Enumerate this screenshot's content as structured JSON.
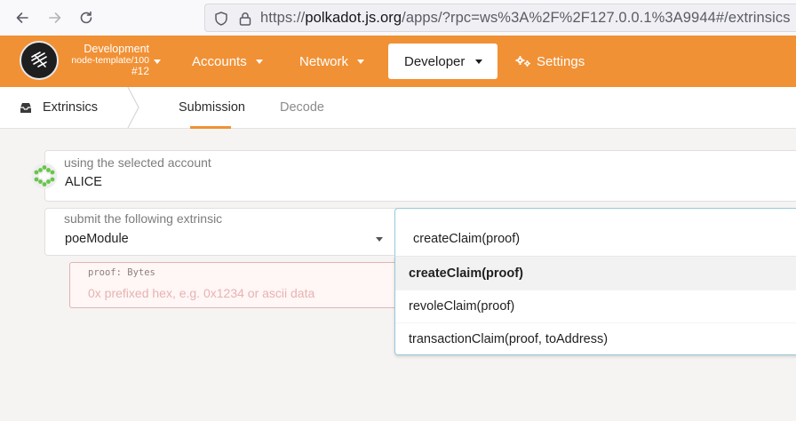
{
  "browser": {
    "url_prefix": "https://",
    "url_host": "polkadot.js.org",
    "url_rest": "/apps/?rpc=ws%3A%2F%2F127.0.0.1%3A9944#/extrinsics"
  },
  "chain": {
    "name": "Development",
    "spec": "node-template/100",
    "block": "#12"
  },
  "menu": {
    "accounts": "Accounts",
    "network": "Network",
    "developer": "Developer",
    "settings": "Settings"
  },
  "subnav": {
    "section": "Extrinsics",
    "tabs": [
      "Submission",
      "Decode"
    ]
  },
  "account": {
    "label": "using the selected account",
    "name": "ALICE"
  },
  "extrinsic": {
    "label": "submit the following extrinsic",
    "module": "poeModule",
    "method": "createClaim(proof)",
    "options": [
      "createClaim(proof)",
      "revoleClaim(proof)",
      "transactionClaim(proof, toAddress)"
    ]
  },
  "param": {
    "label": "proof: Bytes",
    "placeholder": "0x prefixed hex, e.g. 0x1234 or ascii data"
  },
  "colors": {
    "accent": "#f19135",
    "error_bg": "#fff6f6",
    "error_border": "#e0b4b4",
    "dropdown_border": "#96c8da"
  }
}
